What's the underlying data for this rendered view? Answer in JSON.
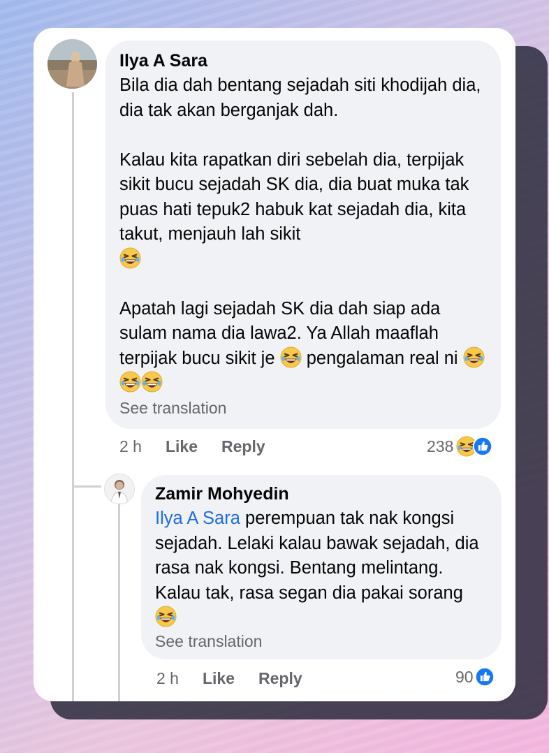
{
  "comments": [
    {
      "author": "Ilya A Sara",
      "paragraphs": [
        "Bila dia dah bentang sejadah siti khodijah dia, dia tak akan berganjak dah.",
        "Kalau kita rapatkan diri sebelah dia, terpijak sikit bucu sejadah SK dia, dia buat muka tak puas hati tepuk2 habuk kat sejadah dia, kita takut, menjauh lah sikit",
        "Apatah lagi sejadah SK dia dah siap ada sulam nama dia lawa2. Ya Allah maaflah terpijak bucu sikit je",
        "pengalaman real ni"
      ],
      "see_translation": "See translation",
      "time": "2 h",
      "like_label": "Like",
      "reply_label": "Reply",
      "reaction_count": "238",
      "reaction_icons": [
        "haha-icon",
        "like-icon"
      ]
    },
    {
      "author": "Zamir Mohyedin",
      "mention": "Ilya A Sara",
      "text": "perempuan tak nak kongsi sejadah. Lelaki kalau bawak sejadah, dia rasa nak kongsi. Bentang melintang. Kalau tak, rasa segan dia pakai sorang",
      "see_translation": "See translation",
      "time": "2 h",
      "like_label": "Like",
      "reply_label": "Reply",
      "reaction_count": "90",
      "reaction_icons": [
        "like-icon"
      ]
    }
  ],
  "colors": {
    "bubble": "#f0f2f5",
    "mention": "#216fdb",
    "meta": "#65676b",
    "like_blue": "#1877f2",
    "haha_yellow": "#f7c94b"
  }
}
